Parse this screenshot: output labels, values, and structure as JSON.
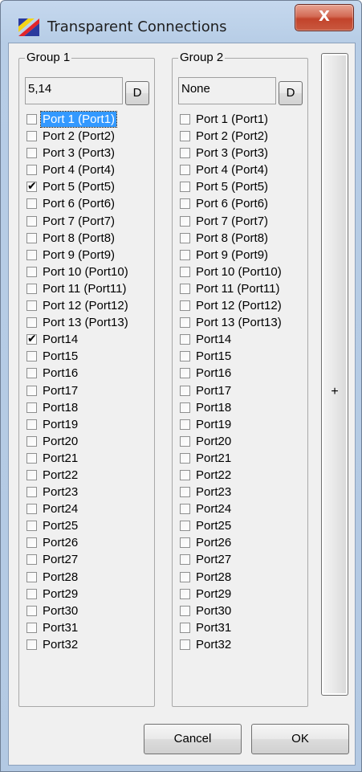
{
  "window": {
    "title": "Transparent Connections",
    "close_label": "X"
  },
  "group1": {
    "legend": "Group 1",
    "value": "5,14",
    "d_label": "D",
    "ports": [
      {
        "label": "Port 1 (Port1)",
        "checked": false,
        "selected": true
      },
      {
        "label": "Port 2 (Port2)",
        "checked": false
      },
      {
        "label": "Port 3 (Port3)",
        "checked": false
      },
      {
        "label": "Port 4 (Port4)",
        "checked": false
      },
      {
        "label": "Port 5 (Port5)",
        "checked": true
      },
      {
        "label": "Port 6 (Port6)",
        "checked": false
      },
      {
        "label": "Port 7 (Port7)",
        "checked": false
      },
      {
        "label": "Port 8 (Port8)",
        "checked": false
      },
      {
        "label": "Port 9 (Port9)",
        "checked": false
      },
      {
        "label": "Port 10 (Port10)",
        "checked": false
      },
      {
        "label": "Port 11 (Port11)",
        "checked": false
      },
      {
        "label": "Port 12 (Port12)",
        "checked": false
      },
      {
        "label": "Port 13 (Port13)",
        "checked": false
      },
      {
        "label": "Port14",
        "checked": true
      },
      {
        "label": "Port15",
        "checked": false
      },
      {
        "label": "Port16",
        "checked": false
      },
      {
        "label": "Port17",
        "checked": false
      },
      {
        "label": "Port18",
        "checked": false
      },
      {
        "label": "Port19",
        "checked": false
      },
      {
        "label": "Port20",
        "checked": false
      },
      {
        "label": "Port21",
        "checked": false
      },
      {
        "label": "Port22",
        "checked": false
      },
      {
        "label": "Port23",
        "checked": false
      },
      {
        "label": "Port24",
        "checked": false
      },
      {
        "label": "Port25",
        "checked": false
      },
      {
        "label": "Port26",
        "checked": false
      },
      {
        "label": "Port27",
        "checked": false
      },
      {
        "label": "Port28",
        "checked": false
      },
      {
        "label": "Port29",
        "checked": false
      },
      {
        "label": "Port30",
        "checked": false
      },
      {
        "label": "Port31",
        "checked": false
      },
      {
        "label": "Port32",
        "checked": false
      }
    ]
  },
  "group2": {
    "legend": "Group 2",
    "value": "None",
    "d_label": "D",
    "ports": [
      {
        "label": "Port 1 (Port1)",
        "checked": false
      },
      {
        "label": "Port 2 (Port2)",
        "checked": false
      },
      {
        "label": "Port 3 (Port3)",
        "checked": false
      },
      {
        "label": "Port 4 (Port4)",
        "checked": false
      },
      {
        "label": "Port 5 (Port5)",
        "checked": false
      },
      {
        "label": "Port 6 (Port6)",
        "checked": false
      },
      {
        "label": "Port 7 (Port7)",
        "checked": false
      },
      {
        "label": "Port 8 (Port8)",
        "checked": false
      },
      {
        "label": "Port 9 (Port9)",
        "checked": false
      },
      {
        "label": "Port 10 (Port10)",
        "checked": false
      },
      {
        "label": "Port 11 (Port11)",
        "checked": false
      },
      {
        "label": "Port 12 (Port12)",
        "checked": false
      },
      {
        "label": "Port 13 (Port13)",
        "checked": false
      },
      {
        "label": "Port14",
        "checked": false
      },
      {
        "label": "Port15",
        "checked": false
      },
      {
        "label": "Port16",
        "checked": false
      },
      {
        "label": "Port17",
        "checked": false
      },
      {
        "label": "Port18",
        "checked": false
      },
      {
        "label": "Port19",
        "checked": false
      },
      {
        "label": "Port20",
        "checked": false
      },
      {
        "label": "Port21",
        "checked": false
      },
      {
        "label": "Port22",
        "checked": false
      },
      {
        "label": "Port23",
        "checked": false
      },
      {
        "label": "Port24",
        "checked": false
      },
      {
        "label": "Port25",
        "checked": false
      },
      {
        "label": "Port26",
        "checked": false
      },
      {
        "label": "Port27",
        "checked": false
      },
      {
        "label": "Port28",
        "checked": false
      },
      {
        "label": "Port29",
        "checked": false
      },
      {
        "label": "Port30",
        "checked": false
      },
      {
        "label": "Port31",
        "checked": false
      },
      {
        "label": "Port32",
        "checked": false
      }
    ]
  },
  "plus_label": "+",
  "footer": {
    "cancel_label": "Cancel",
    "ok_label": "OK"
  },
  "colors": {
    "selection": "#3399ff",
    "close_button": "#c9452d",
    "frame": "#b7cde6"
  }
}
